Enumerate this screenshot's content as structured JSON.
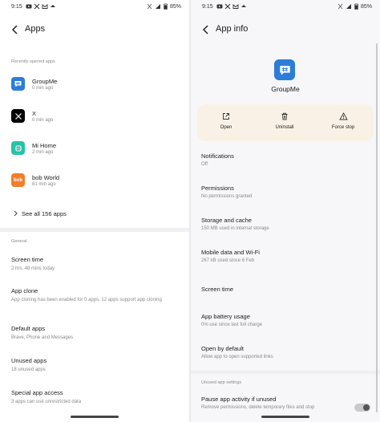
{
  "left": {
    "status": {
      "time": "9:15",
      "battery": "85%"
    },
    "title": "Apps",
    "recent_header": "Recently opened apps",
    "recent_apps": [
      {
        "name": "GroupMe",
        "time": "0 min ago",
        "color": "#2c7dd7"
      },
      {
        "name": "X",
        "time": "0 min ago",
        "color": "#000000"
      },
      {
        "name": "Mi Home",
        "time": "2 min ago",
        "color": "#27c3a7"
      },
      {
        "name": "bob World",
        "time": "81 min ago",
        "color": "#f07e2c"
      }
    ],
    "bob_icon_text": "bob",
    "see_all": "See all 156 apps",
    "general_header": "General",
    "items": [
      {
        "title": "Screen time",
        "sub": "2 hrs, 48 mins today"
      },
      {
        "title": "App clone",
        "sub": "App cloning has been enabled for 0 apps. 12 apps support app cloning"
      },
      {
        "title": "Default apps",
        "sub": "Brave, Phone and Messages"
      },
      {
        "title": "Unused apps",
        "sub": "18 unused apps"
      },
      {
        "title": "Special app access",
        "sub": "3 apps can use unrestricted data"
      }
    ]
  },
  "right": {
    "status": {
      "time": "9:15",
      "battery": "85%"
    },
    "title": "App info",
    "app_name": "GroupMe",
    "actions": [
      {
        "label": "Open",
        "icon": "open-external-icon"
      },
      {
        "label": "Uninstall",
        "icon": "trash-icon"
      },
      {
        "label": "Force stop",
        "icon": "warning-icon"
      }
    ],
    "items": [
      {
        "title": "Notifications",
        "sub": "Off"
      },
      {
        "title": "Permissions",
        "sub": "No permissions granted"
      },
      {
        "title": "Storage and cache",
        "sub": "150 MB used in internal storage"
      },
      {
        "title": "Mobile data and Wi-Fi",
        "sub": "267 kB used since 6 Feb"
      },
      {
        "title": "Screen time",
        "sub": ""
      },
      {
        "title": "App battery usage",
        "sub": "0% use since last full charge"
      },
      {
        "title": "Open by default",
        "sub": "Allow app to open supported links"
      }
    ],
    "unused_header": "Unused app settings",
    "pause": {
      "title": "Pause app activity if unused",
      "sub": "Remove permissions, delete temporary files and stop",
      "enabled": true
    }
  }
}
